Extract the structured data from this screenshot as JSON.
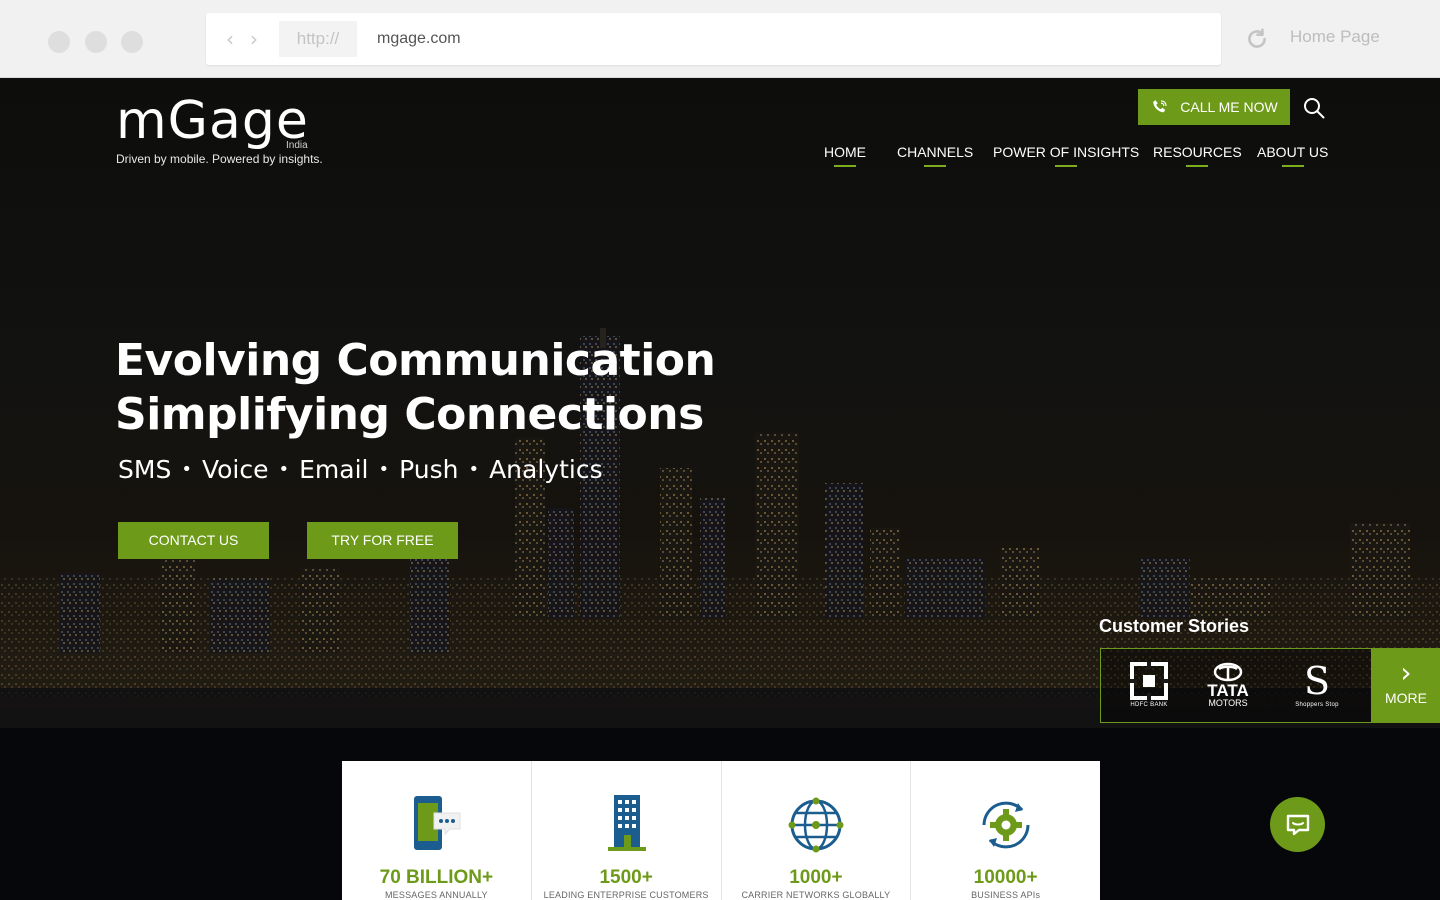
{
  "browser": {
    "protocol": "http://",
    "url": "mgage.com",
    "home_label": "Home Page"
  },
  "brand": {
    "name": "mGage",
    "region": "India",
    "tagline": "Driven by mobile. Powered by insights."
  },
  "header": {
    "call_label": "CALL ME NOW",
    "nav": [
      "HOME",
      "CHANNELS",
      "POWER OF INSIGHTS",
      "RESOURCES",
      "ABOUT US"
    ]
  },
  "hero": {
    "headline_1": "Evolving Communication",
    "headline_2": "Simplifying Connections",
    "services": [
      "SMS",
      "Voice",
      "Email",
      "Push",
      "Analytics"
    ],
    "separator": "•",
    "cta_contact": "CONTACT US",
    "cta_try": "TRY FOR FREE"
  },
  "customer_stories": {
    "title": "Customer Stories",
    "logos": [
      {
        "name": "HDFC BANK",
        "icon": "hdfc-bank-logo"
      },
      {
        "name": "TATA",
        "sub": "MOTORS",
        "icon": "tata-motors-logo"
      },
      {
        "name": "Shoppers Stop",
        "icon": "shoppers-stop-logo"
      }
    ],
    "more_label": "MORE"
  },
  "stats": [
    {
      "value": "70 BILLION+",
      "label": "MESSAGES ANNUALLY",
      "icon": "mobile-message-icon"
    },
    {
      "value": "1500+",
      "label": "LEADING ENTERPRISE CUSTOMERS",
      "icon": "building-icon"
    },
    {
      "value": "1000+",
      "label": "CARRIER NETWORKS GLOBALLY",
      "icon": "globe-network-icon"
    },
    {
      "value": "10000+",
      "label": "BUSINESS APIs",
      "icon": "gear-sync-icon"
    }
  ],
  "colors": {
    "brand_green": "#6e9a1a",
    "accent_green": "#7dac1f",
    "icon_blue": "#1c5d8f",
    "chrome_bg": "#f1f1f1"
  }
}
